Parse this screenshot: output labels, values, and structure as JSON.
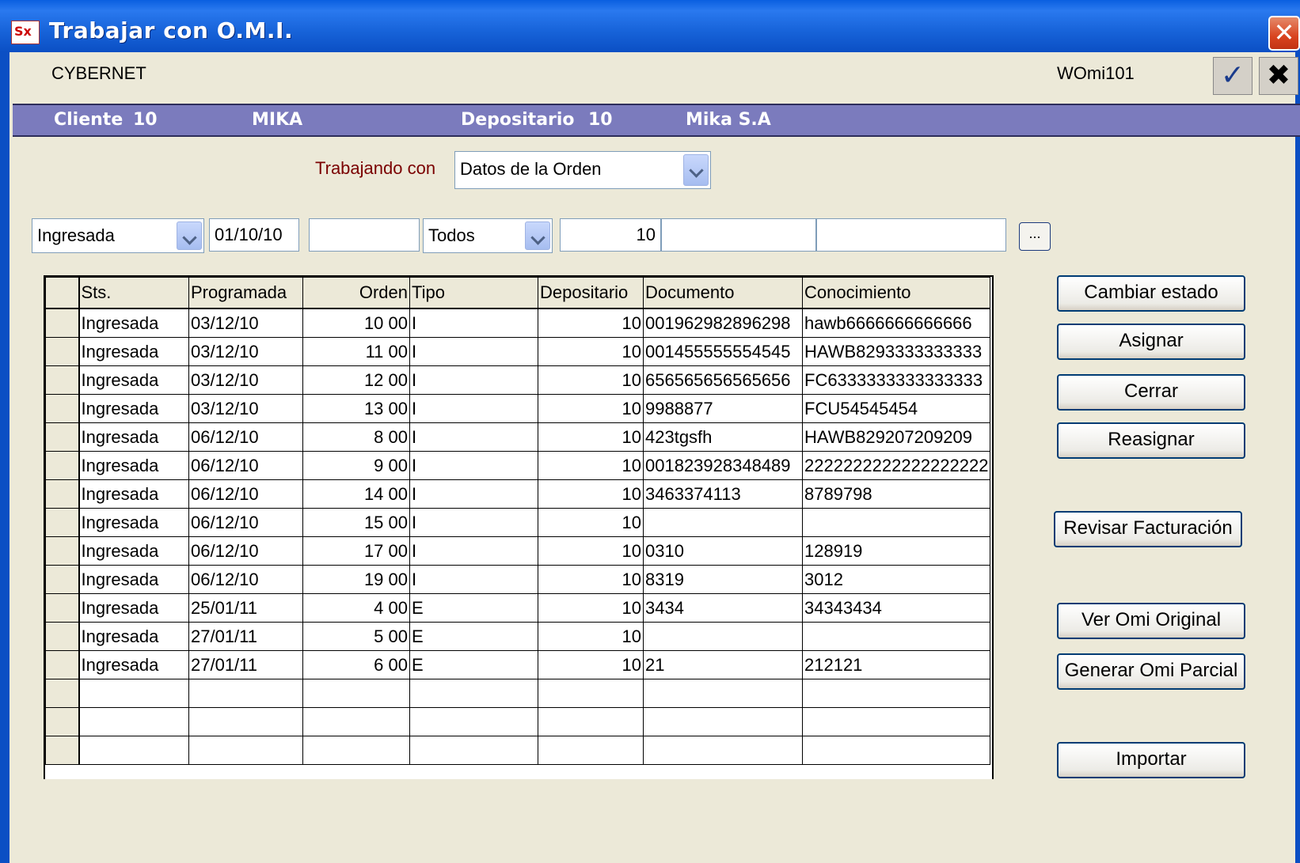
{
  "window": {
    "title": "Trabajar con O.M.I.",
    "icon_text": "Sx",
    "close_symbol": "✕"
  },
  "header": {
    "company": "CYBERNET",
    "program_id": "WOmi101",
    "ok_symbol": "✓",
    "cancel_symbol": "✖"
  },
  "infoband": {
    "cliente_label": "Cliente",
    "cliente_code": "10",
    "cliente_name": "MIKA",
    "depositario_label": "Depositario",
    "depositario_code": "10",
    "depositario_name": "Mika S.A"
  },
  "working_with": {
    "label": "Trabajando con",
    "value": "Datos de la Orden"
  },
  "filters": {
    "status": "Ingresada",
    "date": "01/10/10",
    "field3": "",
    "tipo": "Todos",
    "depositario": "10",
    "field6": "",
    "field7": "",
    "ellipsis": "..."
  },
  "grid": {
    "columns": [
      "Sts.",
      "Programada",
      "Orden",
      "Tipo",
      "Depositario",
      "Documento",
      "Conocimiento"
    ],
    "rows": [
      [
        "Ingresada",
        "03/12/10",
        "10 00",
        "I",
        "10",
        "001962982896298",
        "hawb6666666666666"
      ],
      [
        "Ingresada",
        "03/12/10",
        "11 00",
        "I",
        "10",
        "001455555554545",
        "HAWB8293333333333"
      ],
      [
        "Ingresada",
        "03/12/10",
        "12 00",
        "I",
        "10",
        "656565656565656",
        "FC6333333333333333"
      ],
      [
        "Ingresada",
        "03/12/10",
        "13 00",
        "I",
        "10",
        "9988877",
        "FCU54545454"
      ],
      [
        "Ingresada",
        "06/12/10",
        "8 00",
        "I",
        "10",
        "423tgsfh",
        "HAWB829207209209"
      ],
      [
        "Ingresada",
        "06/12/10",
        "9 00",
        "I",
        "10",
        "001823928348489",
        "2222222222222222222"
      ],
      [
        "Ingresada",
        "06/12/10",
        "14 00",
        "I",
        "10",
        "3463374113",
        "8789798"
      ],
      [
        "Ingresada",
        "06/12/10",
        "15 00",
        "I",
        "10",
        "",
        ""
      ],
      [
        "Ingresada",
        "06/12/10",
        "17 00",
        "I",
        "10",
        "0310",
        "128919"
      ],
      [
        "Ingresada",
        "06/12/10",
        "19 00",
        "I",
        "10",
        "8319",
        "3012"
      ],
      [
        "Ingresada",
        "25/01/11",
        "4 00",
        "E",
        "10",
        "3434",
        "34343434"
      ],
      [
        "Ingresada",
        "27/01/11",
        "5 00",
        "E",
        "10",
        "",
        ""
      ],
      [
        "Ingresada",
        "27/01/11",
        "6 00",
        "E",
        "10",
        "21",
        "212121"
      ],
      [
        "",
        "",
        "",
        "",
        "",
        "",
        ""
      ],
      [
        "",
        "",
        "",
        "",
        "",
        "",
        ""
      ],
      [
        "",
        "",
        "",
        "",
        "",
        "",
        ""
      ]
    ]
  },
  "actions": {
    "cambiar_estado": "Cambiar estado",
    "asignar": "Asignar",
    "cerrar": "Cerrar",
    "reasignar": "Reasignar",
    "revisar_facturacion": "Revisar Facturación",
    "ver_omi_original": "Ver Omi Original",
    "generar_omi_parcial": "Generar Omi Parcial",
    "importar": "Importar"
  }
}
